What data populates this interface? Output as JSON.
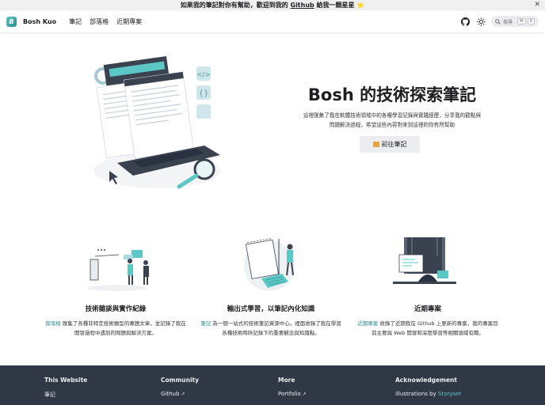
{
  "announcement": {
    "prefix": "如果我的筆記對你有幫助，歡迎到我的 ",
    "link": "Github",
    "suffix": " 給我一顆星星 ⭐",
    "close": "✕"
  },
  "navbar": {
    "logo_letter": "B",
    "brand": "Bosh Kuo",
    "links": [
      "筆記",
      "部落格",
      "近期專案"
    ],
    "search_placeholder": "搜尋",
    "search_keys": [
      "⌘",
      "K"
    ]
  },
  "hero": {
    "title": "Bosh 的技術探索筆記",
    "subtitle_line1": "這裡匯集了我在軟體技術領域中的各種學習記錄與實踐經歷，分享我的觀點與",
    "subtitle_line2": "問題解決過程，希望這些內容對來到這裡的你有所幫助",
    "button_label": "前往筆記"
  },
  "features": [
    {
      "title": "技術雜談與實作紀錄",
      "link": "部落格",
      "desc_after_link": " 匯集了各種非特定技術類型的專題文章，並記錄了我在開發過程中遇到的問題與解決方案。"
    },
    {
      "title": "輸出式學習，以筆記內化知識",
      "link": "筆記",
      "desc_after_link": " 為一個一站式的技術筆記資源中心，裡面收錄了我在學習各種技術時所記錄下的重要觀念與知識點。"
    },
    {
      "title": "近期專案",
      "link": "近期專案",
      "desc_after_link": " 收錄了近期我在 Github 上更新的專案，我的專案目前主要與 Web 開發和深度學習等相關領域有關。"
    }
  ],
  "footer": {
    "columns": [
      {
        "title": "This Website",
        "items": [
          "筆記"
        ]
      },
      {
        "title": "Community",
        "items": [
          "Github"
        ]
      },
      {
        "title": "More",
        "items": [
          "Portfolio"
        ]
      },
      {
        "title": "Acknowledgement",
        "items_prefix": "illustrations by ",
        "items_link": "Storyset"
      }
    ]
  },
  "colors": {
    "accent": "#2e8b8a",
    "accent_light": "#5cc7c5",
    "footer_bg": "#303846",
    "button_bg": "#ebedf0"
  }
}
